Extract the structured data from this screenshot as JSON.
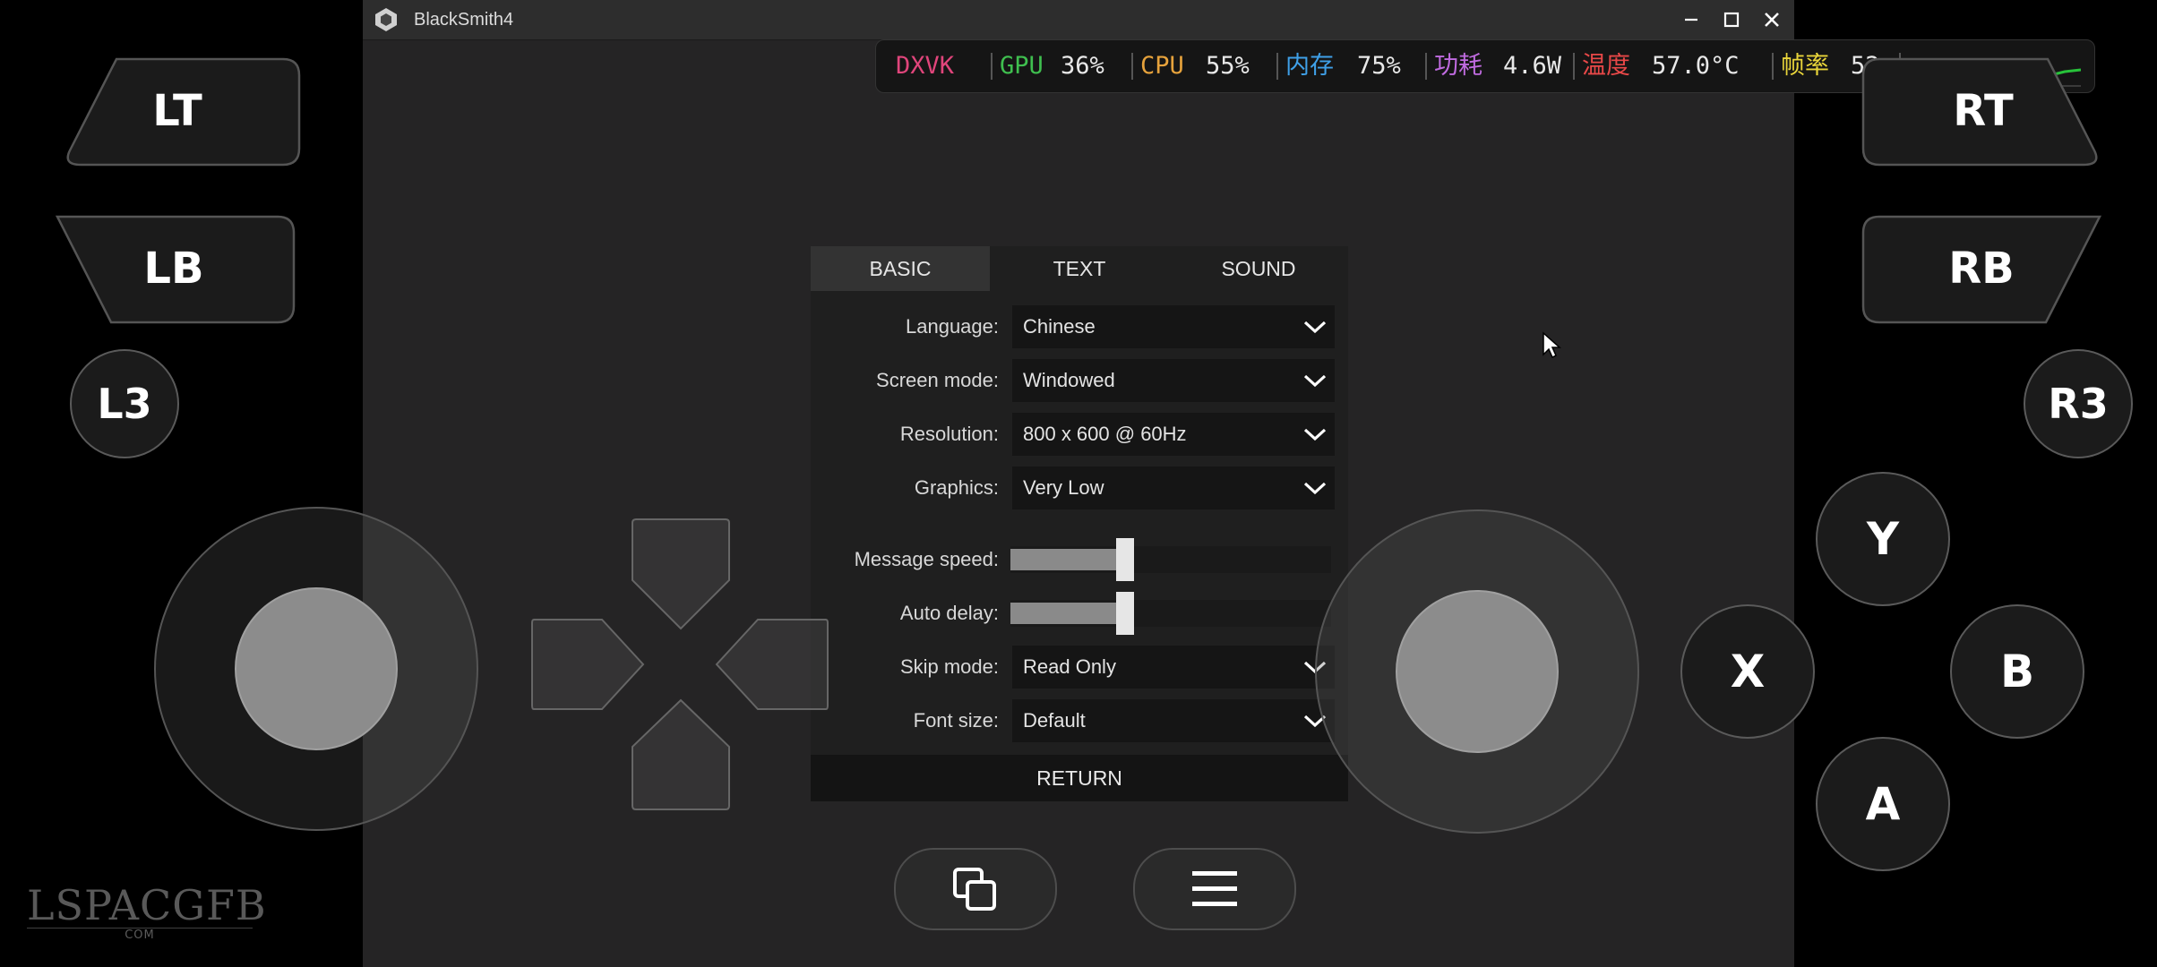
{
  "window": {
    "title": "BlackSmith4"
  },
  "hud": {
    "dxvk": "DXVK",
    "gpu_label": "GPU",
    "gpu_value": "36%",
    "cpu_label": "CPU",
    "cpu_value": "55%",
    "mem_label": "内存",
    "mem_value": "75%",
    "power_label": "功耗",
    "power_value": "4.6W",
    "temp_label": "温度",
    "temp_value": "57.0°C",
    "fps_label": "帧率",
    "fps_value": "52",
    "colors": {
      "dxvk": "#e0457b",
      "gpu": "#3fbf4f",
      "cpu": "#e6a23c",
      "mem": "#3fa0e8",
      "power": "#c06be0",
      "temp": "#e84848",
      "fps": "#e8d43a",
      "graph": "#27c23a"
    }
  },
  "settings": {
    "tabs": [
      {
        "label": "BASIC"
      },
      {
        "label": "TEXT"
      },
      {
        "label": "SOUND"
      }
    ],
    "rows": {
      "language": {
        "label": "Language:",
        "value": "Chinese"
      },
      "screen_mode": {
        "label": "Screen mode:",
        "value": "Windowed"
      },
      "resolution": {
        "label": "Resolution:",
        "value": "800 x 600 @ 60Hz"
      },
      "graphics": {
        "label": "Graphics:",
        "value": "Very Low"
      },
      "message_speed": {
        "label": "Message speed:",
        "level": 0.33
      },
      "auto_delay": {
        "label": "Auto delay:",
        "level": 0.33
      },
      "skip_mode": {
        "label": "Skip mode:",
        "value": "Read Only"
      },
      "font_size": {
        "label": "Font size:",
        "value": "Default"
      }
    },
    "return_label": "RETURN"
  },
  "gamepad": {
    "lt": "LT",
    "lb": "LB",
    "l3": "L3",
    "rt": "RT",
    "rb": "RB",
    "r3": "R3",
    "y": "Y",
    "x": "X",
    "b": "B",
    "a": "A"
  },
  "watermark": {
    "main": "LSPACGFB",
    "sub": "COM"
  }
}
